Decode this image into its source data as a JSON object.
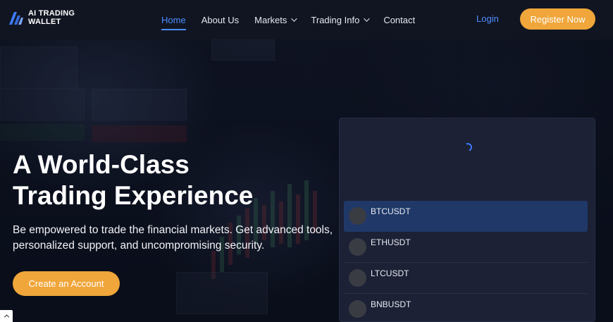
{
  "brand": {
    "line1": "AI TRADING",
    "line2": "WALLET",
    "accent": "#3d7bff"
  },
  "nav": {
    "items": [
      {
        "label": "Home",
        "active": true
      },
      {
        "label": "About Us",
        "dropdown": false
      },
      {
        "label": "Markets",
        "dropdown": true
      },
      {
        "label": "Trading Info",
        "dropdown": true
      },
      {
        "label": "Contact",
        "dropdown": false
      }
    ],
    "login": "Login",
    "register": "Register Now"
  },
  "hero": {
    "title_line1": "A World-Class",
    "title_line2": "Trading Experience",
    "subtitle": "Be empowered to trade the financial markets. Get advanced tools, personalized support, and uncompromising security.",
    "cta": "Create an Account"
  },
  "widget": {
    "loading": true,
    "tickers": [
      {
        "symbol": "BTCUSDT",
        "selected": true
      },
      {
        "symbol": "ETHUSDT",
        "selected": false
      },
      {
        "symbol": "LTCUSDT",
        "selected": false
      },
      {
        "symbol": "BNBUSDT",
        "selected": false
      }
    ]
  },
  "colors": {
    "primary": "#f0a63a",
    "link": "#4d8dff",
    "navbar": "#111522",
    "widget": "#1c2135",
    "selected_row": "#1f3868"
  },
  "icons": {
    "scroll_top": "chevron-up-icon"
  }
}
